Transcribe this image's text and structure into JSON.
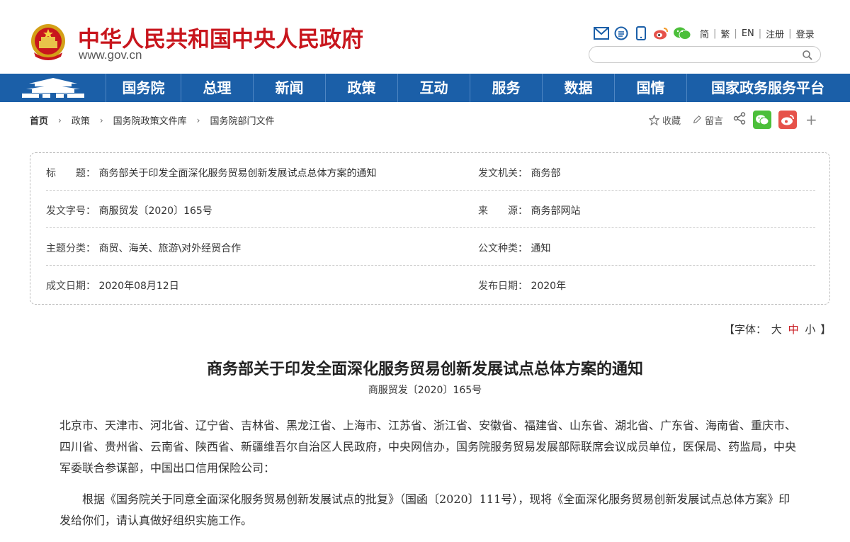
{
  "header": {
    "site_title": "中华人民共和国中央人民政府",
    "site_url": "www.gov.cn",
    "lang_links": [
      "简",
      "繁",
      "EN",
      "注册",
      "登录"
    ],
    "search_placeholder": ""
  },
  "nav": {
    "items": [
      "国务院",
      "总理",
      "新闻",
      "政策",
      "互动",
      "服务",
      "数据",
      "国情",
      "国家政务服务平台"
    ]
  },
  "breadcrumb": [
    "首页",
    "政策",
    "国务院政策文件库",
    "国务院部门文件"
  ],
  "actions": {
    "favorite": "收藏",
    "comment": "留言"
  },
  "info": {
    "rows": [
      {
        "l1": "标　　题：",
        "v1": "商务部关于印发全面深化服务贸易创新发展试点总体方案的通知",
        "l2": "发文机关：",
        "v2": "商务部"
      },
      {
        "l1": "发文字号：",
        "v1": "商服贸发〔2020〕165号",
        "l2": "来　　源：",
        "v2": "商务部网站"
      },
      {
        "l1": "主题分类：",
        "v1": "商贸、海关、旅游\\对外经贸合作",
        "l2": "公文种类：",
        "v2": "通知"
      },
      {
        "l1": "成文日期：",
        "v1": "2020年08月12日",
        "l2": "发布日期：",
        "v2": "2020年"
      }
    ]
  },
  "font_control": {
    "prefix": "【字体：",
    "large": "大",
    "medium": "中",
    "small": "小",
    "suffix": "】"
  },
  "article": {
    "title": "商务部关于印发全面深化服务贸易创新发展试点总体方案的通知",
    "doc_no": "商服贸发〔2020〕165号",
    "para1": "北京市、天津市、河北省、辽宁省、吉林省、黑龙江省、上海市、江苏省、浙江省、安徽省、福建省、山东省、湖北省、广东省、海南省、重庆市、四川省、贵州省、云南省、陕西省、新疆维吾尔自治区人民政府，中央网信办，国务院服务贸易发展部际联席会议成员单位，医保局、药监局，中央军委联合参谋部，中国出口信用保险公司：",
    "para2": "根据《国务院关于同意全面深化服务贸易创新发展试点的批复》（国函〔2020〕111号），现将《全面深化服务贸易创新发展试点总体方案》印发给你们，请认真做好组织实施工作。"
  },
  "colors": {
    "brand_red": "#c8161d",
    "nav_blue": "#1b5fa8",
    "wechat_green": "#4cbf3a",
    "weibo_red": "#e6524a"
  }
}
